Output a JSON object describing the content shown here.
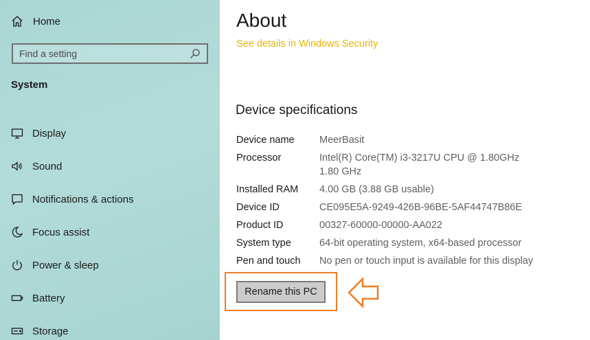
{
  "sidebar": {
    "home_label": "Home",
    "search_placeholder": "Find a setting",
    "section_title": "System",
    "items": [
      {
        "label": "Display",
        "icon": "display-icon"
      },
      {
        "label": "Sound",
        "icon": "sound-icon"
      },
      {
        "label": "Notifications & actions",
        "icon": "notifications-icon"
      },
      {
        "label": "Focus assist",
        "icon": "focus-assist-icon"
      },
      {
        "label": "Power & sleep",
        "icon": "power-icon"
      },
      {
        "label": "Battery",
        "icon": "battery-icon"
      },
      {
        "label": "Storage",
        "icon": "storage-icon"
      }
    ]
  },
  "main": {
    "title": "About",
    "security_link": "See details in Windows Security",
    "spec_heading": "Device specifications",
    "specs": [
      {
        "key": "Device name",
        "value": "MeerBasit"
      },
      {
        "key": "Processor",
        "value": "Intel(R) Core(TM) i3-3217U CPU @ 1.80GHz   1.80 GHz"
      },
      {
        "key": "Installed RAM",
        "value": "4.00 GB (3.88 GB usable)"
      },
      {
        "key": "Device ID",
        "value": "CE095E5A-9249-426B-96BE-5AF44747B86E"
      },
      {
        "key": "Product ID",
        "value": "00327-60000-00000-AA022"
      },
      {
        "key": "System type",
        "value": "64-bit operating system, x64-based processor"
      },
      {
        "key": "Pen and touch",
        "value": "No pen or touch input is available for this display"
      }
    ],
    "rename_button": "Rename this PC"
  },
  "colors": {
    "sidebar_bg": "#abd7d4",
    "link": "#e9b400",
    "highlight": "#ef7d22"
  }
}
